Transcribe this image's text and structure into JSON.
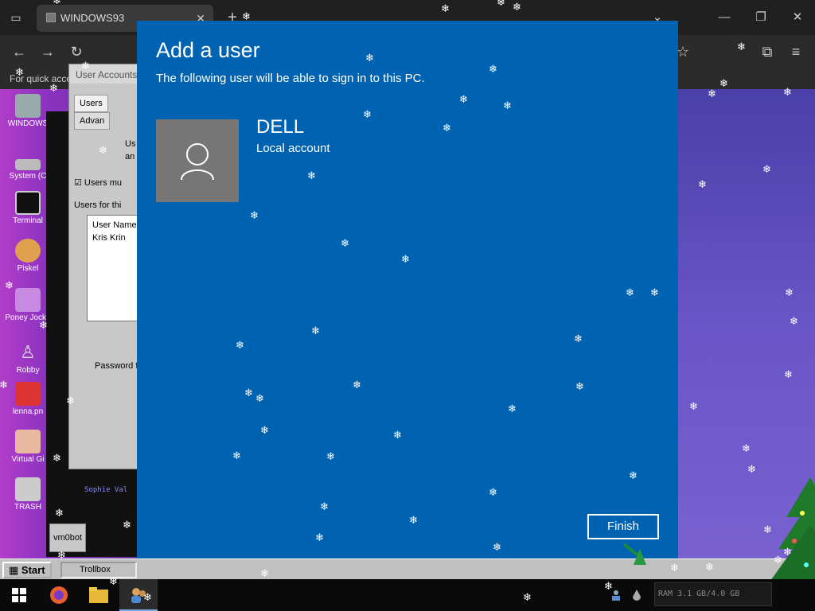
{
  "browser": {
    "tab_title": "WINDOWS93",
    "tab_close_glyph": "✕",
    "new_tab_glyph": "+",
    "bookmarks_hint": "For quick acce"
  },
  "desktop": {
    "icons": [
      {
        "label": "WINDOWS",
        "icon": "computer-icon"
      },
      {
        "label": "System (C",
        "icon": "drive-icon"
      },
      {
        "label": "Terminal",
        "icon": "terminal-icon"
      },
      {
        "label": "Piskel",
        "icon": "palette-icon"
      },
      {
        "label": "Poney Jocke",
        "icon": "pony-icon"
      },
      {
        "label": "Robby",
        "icon": "robot-icon"
      },
      {
        "label": "lenna.pn",
        "icon": "image-icon"
      },
      {
        "label": "Virtual Gi",
        "icon": "face-icon"
      },
      {
        "label": "TRASH",
        "icon": "trash-icon"
      }
    ]
  },
  "users_window": {
    "title": "User Accounts",
    "tabs": [
      "Users",
      "Advan"
    ],
    "text_fragments": [
      "Us",
      "an",
      "Users mu",
      "Users for thi",
      "User Name",
      "Kris Krin",
      "Password f"
    ]
  },
  "terminal": {
    "lines": [
      "Sophie Val",
      "vm0bot"
    ]
  },
  "retro_taskbar": {
    "start_label": "Start",
    "trollbox_label": "Trollbox"
  },
  "dialog": {
    "title": "Add a user",
    "subtitle": "The following user will be able to sign in to this PC.",
    "user_name": "DELL",
    "account_type": "Local account",
    "finish_label": "Finish"
  },
  "system_tray": {
    "perf_text": "RAM  3.1 GB/4.0 GB"
  },
  "colors": {
    "dialog_bg": "#0063b1",
    "avatar_bg": "#767676",
    "accent": "#ffffff"
  }
}
